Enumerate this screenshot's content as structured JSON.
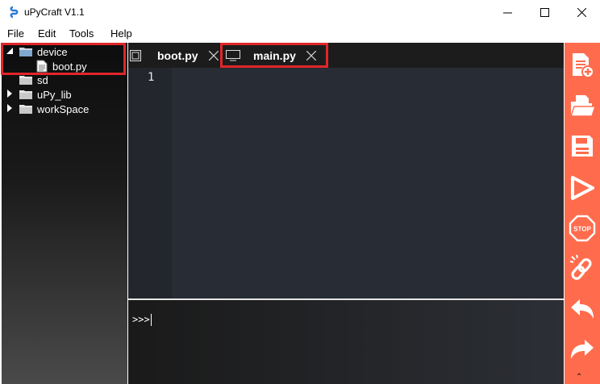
{
  "window": {
    "title": "uPyCraft V1.1"
  },
  "menu": [
    "File",
    "Edit",
    "Tools",
    "Help"
  ],
  "tree": {
    "device": "device",
    "device_file": "boot.py",
    "sd": "sd",
    "upy_lib": "uPy_lib",
    "workspace": "workSpace"
  },
  "tabs": [
    {
      "label": "boot.py"
    },
    {
      "label": "main.py"
    }
  ],
  "editor": {
    "line_number": "1"
  },
  "terminal": {
    "prompt": ">>>"
  },
  "toolbar": {
    "icons": [
      "new-file-icon",
      "open-folder-icon",
      "save-icon",
      "run-icon",
      "stop-icon",
      "connect-icon",
      "undo-icon",
      "redo-icon"
    ]
  },
  "colors": {
    "toolbar": "#ff6c4d",
    "highlight": "#e0262a",
    "editor_bg": "#282c34"
  }
}
